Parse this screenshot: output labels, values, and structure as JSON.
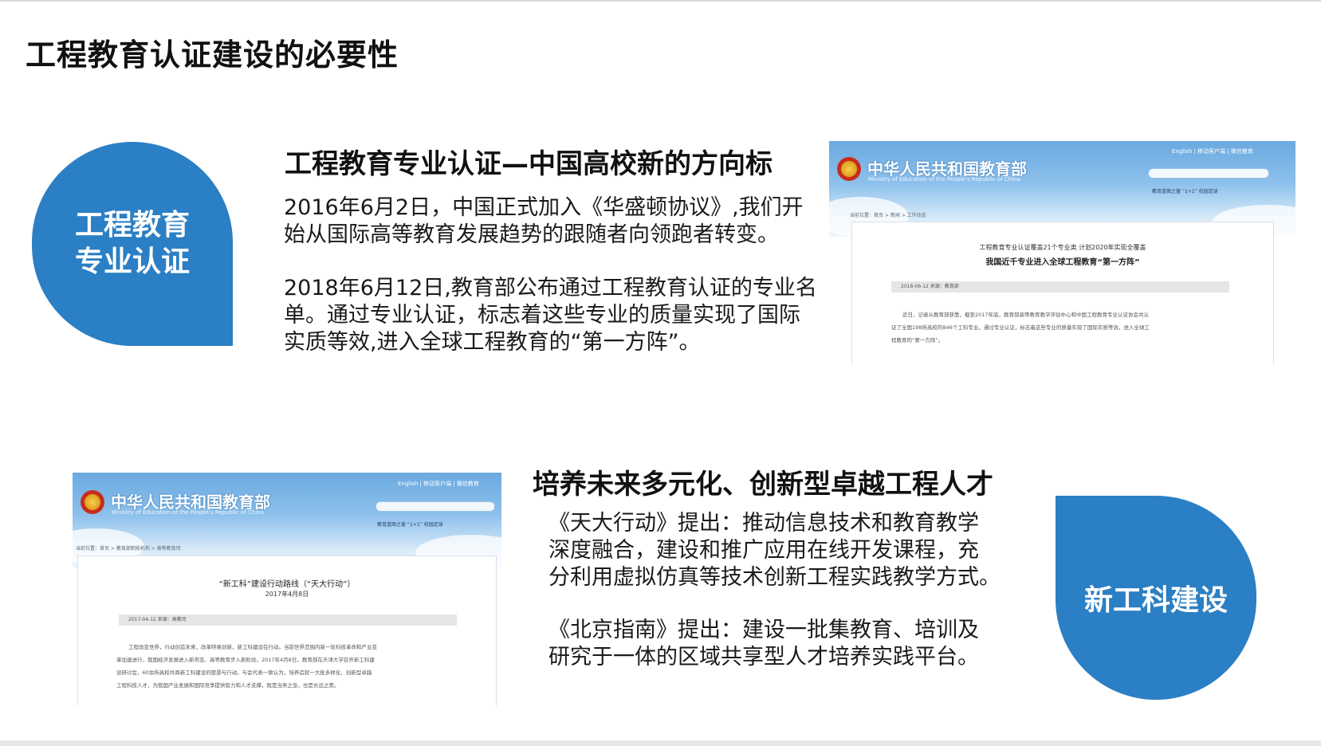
{
  "page_title": "工程教育认证建设的必要性",
  "section1": {
    "badge_lines": [
      "工程教育",
      "专业认证"
    ],
    "heading": "工程教育专业认证—中国高校新的方向标",
    "paragraphs": [
      [
        "2016年6月2日，中国正式加入《华盛顿协议》,我们开",
        "始从国际高等教育发展趋势的跟随者向领跑者转变。"
      ],
      [
        "2018年6月12日,教育部公布通过工程教育认证的专业名",
        "单。通过专业认证，标志着这些专业的质量实现了国际",
        "实质等效,进入全球工程教育的“第一方阵”。"
      ]
    ],
    "screenshot": {
      "ministry_name": "中华人民共和国教育部",
      "ministry_en": "Ministry of Education of the People's Republic of China",
      "top_links": "English  |  移动客户端  |  微信教育",
      "quick_links": "教育蓝图之窗 “1+1”   校园足球",
      "breadcrumb": "当前位置：首页  >  新闻  >  工作动态",
      "article_subtitle": "工程教育专业认证覆盖21个专业类 计划2020年实现全覆盖",
      "article_title": "我国近千专业进入全球工程教育“第一方阵”",
      "meta": "2018-06-12    来源：教育部",
      "body_lines": [
        "近日，记者从教育部获悉，截至2017年底，教育部高等教育教学评估中心和中国工程教育专业认证协会共认",
        "证了全国198所高校的846个工科专业。通过专业认证，标志着这些专业的质量实现了国际实质等效，进入全球工",
        "程教育的“第一方阵”。"
      ]
    }
  },
  "section2": {
    "badge_label": "新工科建设",
    "heading": "培养未来多元化、创新型卓越工程人才",
    "paragraphs": [
      [
        "《天大行动》提出：推动信息技术和教育教学",
        "深度融合，建设和推广应用在线开发课程，充",
        "分利用虚拟仿真等技术创新工程实践教学方式。"
      ],
      [
        "《北京指南》提出：建设一批集教育、培训及",
        "研究于一体的区域共享型人才培养实践平台。"
      ]
    ],
    "screenshot": {
      "ministry_name": "中华人民共和国教育部",
      "ministry_en": "Ministry of Education of the People's Republic of China",
      "top_links": "English  |  移动客户端  |  微信教育",
      "quick_links": "教育蓝图之窗 “1+1”   校园足球",
      "breadcrumb": "当前位置：首页  >  教育部职能机构  >  高等教育司",
      "article_title": "“新工科”建设行动路线（“天大行动”）",
      "article_date": "2017年4月8日",
      "meta": "2017-04-12    来源：高教司",
      "body_lines": [
        "工程改变世界，行动创造未来，改革呼唤创新，新工科建设在行动。当前世界范围内新一轮科技革命和产业变",
        "革加速进行，我国经济发展进入新常态、高等教育步入新阶段。2017年4月8日，教育部在天津大学召开新工科建",
        "设研讨会，60余所高校共商新工科建设的愿景与行动。与会代表一致认为，培养造就一大批多样化、创新型卓越",
        "工程科技人才，为我国产业发展和国际竞争提供智力和人才支撑，既是当务之急，也是长远之策。"
      ]
    }
  }
}
